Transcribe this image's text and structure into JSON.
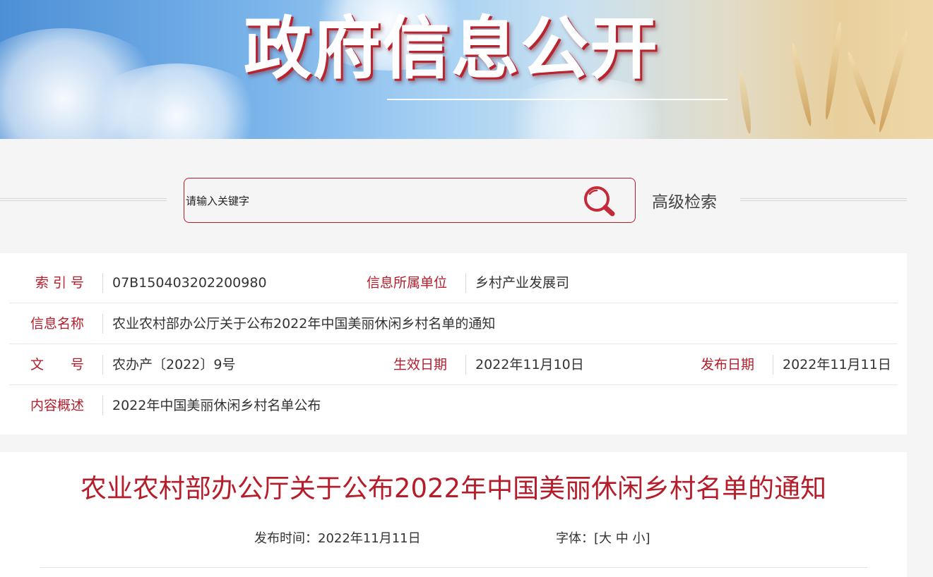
{
  "banner": {
    "title": "政府信息公开"
  },
  "search": {
    "placeholder": "请输入关键字",
    "icon": "search-icon",
    "advanced_label": "高级检索",
    "accent_color": "#b51d2b"
  },
  "meta": {
    "index_label": "索 引 号",
    "index_value": "07B150403202200980",
    "unit_label": "信息所属单位",
    "unit_value": "乡村产业发展司",
    "name_label": "信息名称",
    "name_value": "农业农村部办公厅关于公布2022年中国美丽休闲乡村名单的通知",
    "doc_label": "文　　号",
    "doc_value": "农办产〔2022〕9号",
    "effective_label": "生效日期",
    "effective_value": "2022年11月10日",
    "publish_label": "发布日期",
    "publish_value": "2022年11月11日",
    "summary_label": "内容概述",
    "summary_value": "2022年中国美丽休闲乡村名单公布"
  },
  "article": {
    "title": "农业农村部办公厅关于公布2022年中国美丽休闲乡村名单的通知",
    "pub_label": "发布时间：",
    "pub_date": "2022年11月11日",
    "font_label": "字体：",
    "font_open": "[",
    "font_large": "大",
    "font_medium": "中",
    "font_small": "小",
    "font_close": "]"
  }
}
